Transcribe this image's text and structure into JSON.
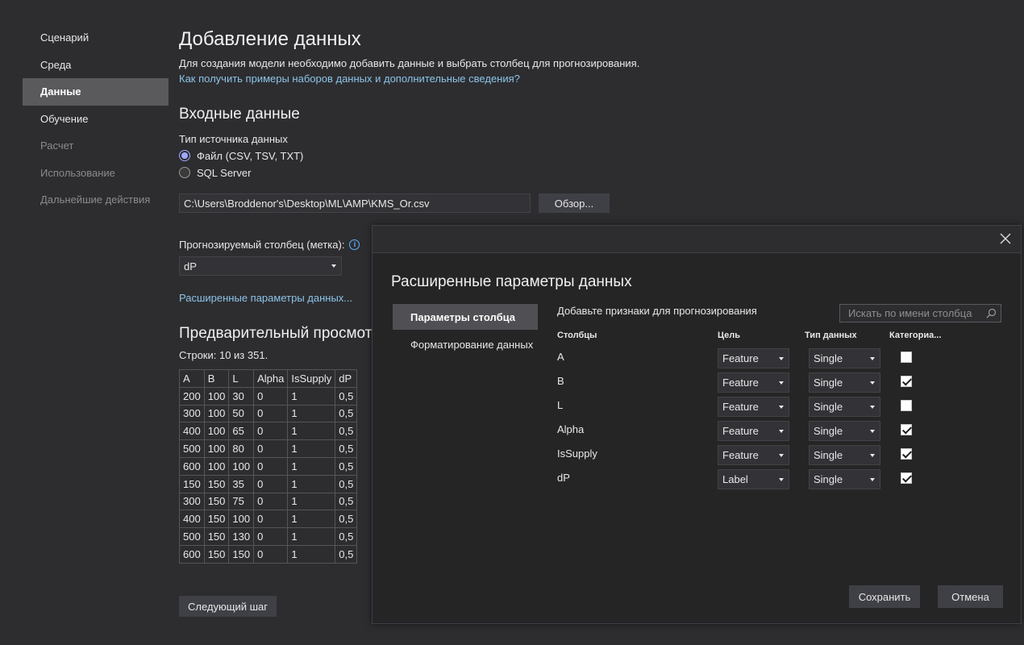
{
  "sidebar": {
    "items": [
      {
        "label": "Сценарий",
        "state": "normal"
      },
      {
        "label": "Среда",
        "state": "normal"
      },
      {
        "label": "Данные",
        "state": "active"
      },
      {
        "label": "Обучение",
        "state": "normal"
      },
      {
        "label": "Расчет",
        "state": "disabled"
      },
      {
        "label": "Использование",
        "state": "disabled"
      },
      {
        "label": "Дальнейшие действия",
        "state": "disabled"
      }
    ]
  },
  "main": {
    "title": "Добавление данных",
    "description": "Для создания модели необходимо добавить данные и выбрать столбец для прогнозирования.",
    "help_link": "Как получить примеры наборов данных и дополнительные сведения?",
    "input_section_title": "Входные данные",
    "source_type_label": "Тип источника данных",
    "source_options": [
      {
        "label": "Файл (CSV, TSV, TXT)",
        "selected": true
      },
      {
        "label": "SQL Server",
        "selected": false
      }
    ],
    "file_path": "C:\\Users\\Broddenor's\\Desktop\\ML\\AMP\\KMS_Or.csv",
    "browse_label": "Обзор...",
    "predict_label": "Прогнозируемый столбец (метка):",
    "predict_value": "dP",
    "advanced_link": "Расширенные параметры данных...",
    "preview_title": "Предварительный просмотр данных",
    "rows_label": "Строки: 10 из 351.",
    "next_label": "Следующий шаг"
  },
  "preview_table": {
    "headers": [
      "A",
      "B",
      "L",
      "Alpha",
      "IsSupply",
      "dP"
    ],
    "rows": [
      [
        "200",
        "100",
        "30",
        "0",
        "1",
        "0,5"
      ],
      [
        "300",
        "100",
        "50",
        "0",
        "1",
        "0,5"
      ],
      [
        "400",
        "100",
        "65",
        "0",
        "1",
        "0,5"
      ],
      [
        "500",
        "100",
        "80",
        "0",
        "1",
        "0,5"
      ],
      [
        "600",
        "100",
        "100",
        "0",
        "1",
        "0,5"
      ],
      [
        "150",
        "150",
        "35",
        "0",
        "1",
        "0,5"
      ],
      [
        "300",
        "150",
        "75",
        "0",
        "1",
        "0,5"
      ],
      [
        "400",
        "150",
        "100",
        "0",
        "1",
        "0,5"
      ],
      [
        "500",
        "150",
        "130",
        "0",
        "1",
        "0,5"
      ],
      [
        "600",
        "150",
        "150",
        "0",
        "1",
        "0,5"
      ]
    ]
  },
  "dialog": {
    "title": "Расширенные параметры данных",
    "tabs": [
      {
        "label": "Параметры столбца",
        "active": true
      },
      {
        "label": "Форматирование данных",
        "active": false
      }
    ],
    "instruction": "Добавьте признаки для прогнозирования",
    "search_placeholder": "Искать по имени столбца",
    "column_headers": {
      "columns": "Столбцы",
      "target": "Цель",
      "data_type": "Тип данных",
      "categorical": "Категориа..."
    },
    "rows": [
      {
        "name": "A",
        "target": "Feature",
        "type": "Single",
        "categorical": false
      },
      {
        "name": "B",
        "target": "Feature",
        "type": "Single",
        "categorical": true
      },
      {
        "name": "L",
        "target": "Feature",
        "type": "Single",
        "categorical": false
      },
      {
        "name": "Alpha",
        "target": "Feature",
        "type": "Single",
        "categorical": true
      },
      {
        "name": "IsSupply",
        "target": "Feature",
        "type": "Single",
        "categorical": true
      },
      {
        "name": "dP",
        "target": "Label",
        "type": "Single",
        "categorical": true
      }
    ],
    "save_label": "Сохранить",
    "cancel_label": "Отмена"
  }
}
